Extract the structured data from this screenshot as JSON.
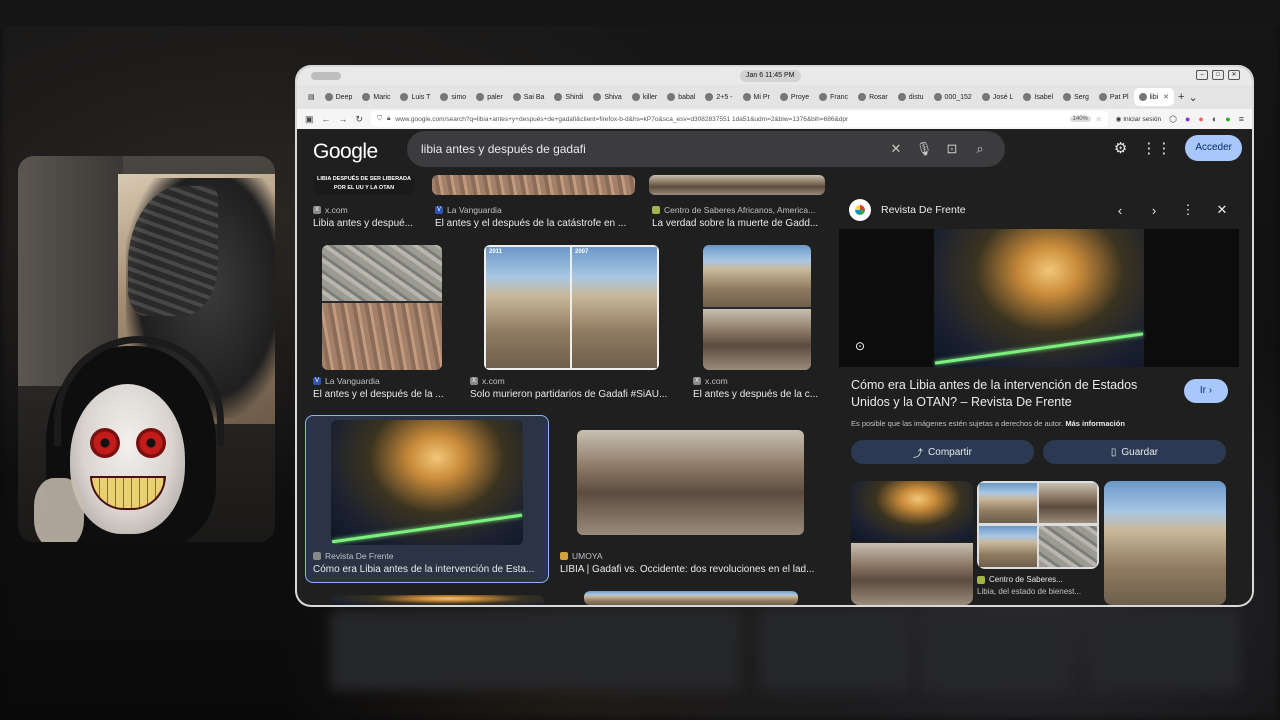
{
  "os": {
    "clock": "Jan 6  11:45 PM"
  },
  "browser": {
    "tabs": [
      {
        "label": "Deep"
      },
      {
        "label": "Maric"
      },
      {
        "label": "Luis T"
      },
      {
        "label": "simo"
      },
      {
        "label": "paler"
      },
      {
        "label": "Sai Ba"
      },
      {
        "label": "Shirdi"
      },
      {
        "label": "Shiva"
      },
      {
        "label": "killer"
      },
      {
        "label": "babal"
      },
      {
        "label": "2+5 -"
      },
      {
        "label": "Mi Pr"
      },
      {
        "label": "Proye"
      },
      {
        "label": "Franc"
      },
      {
        "label": "Rosar"
      },
      {
        "label": "distu"
      },
      {
        "label": "000_152"
      },
      {
        "label": "José L"
      },
      {
        "label": "Isabel"
      },
      {
        "label": "Serg"
      },
      {
        "label": "Pat Pl"
      },
      {
        "label": "libi"
      }
    ],
    "url": "www.google.com/search?q=libia+antes+y+después+de+gadafi&client=firefox-b-d&hs=kP7o&sca_esv=d3082837551 1da51&udm=2&biw=1376&bih=686&dpr",
    "zoom": "140%",
    "session": "Iniciar sesión"
  },
  "google": {
    "logo": "Google",
    "query": "libia antes y después de gadafi",
    "signin": "Acceder"
  },
  "results": {
    "row1": [
      {
        "source": "x.com",
        "title": "Libia antes y despué...",
        "banner": "LIBIA DESPUÉS DE SER LIBERADA POR EL UU Y LA OTAN"
      },
      {
        "source": "La Vanguardia",
        "title": "El antes y el después de la catástrofe en ..."
      },
      {
        "source": "Centro de Saberes Africanos, America...",
        "title": "La verdad sobre la muerte de Gadd..."
      }
    ],
    "row2": [
      {
        "source": "La Vanguardia",
        "title": "El antes y el después de la ..."
      },
      {
        "source": "x.com",
        "title": "Solo murieron partidarios de Gadafi #SiAU...",
        "year1": "2011",
        "year2": "2007"
      },
      {
        "source": "x.com",
        "title": "El antes y después de la c..."
      }
    ],
    "row3": [
      {
        "source": "Revista De Frente",
        "title": "Cómo era Libia antes de la intervención de Esta..."
      },
      {
        "source": "UMOYA",
        "title": "LIBIA | Gadafi vs. Occidente: dos revoluciones en el lad..."
      }
    ]
  },
  "panel": {
    "site": "Revista De Frente",
    "title": "Cómo era Libia antes de la intervención de Estados Unidos y la OTAN? – Revista De Frente",
    "go": "Ir ›",
    "note": "Es posible que las imágenes estén sujetas a derechos de autor.",
    "more": "Más información",
    "share": "Compartir",
    "save": "Guardar",
    "related_source": "Centro de Saberes...",
    "related_title": "Libia, del estado de bienest..."
  },
  "icons": {
    "clear": "close-icon",
    "mic": "microphone-icon",
    "lens": "camera-search-icon",
    "search": "search-icon",
    "settings": "gear-icon",
    "apps": "apps-grid-icon"
  },
  "colors": {
    "accent": "#a8c7fa",
    "selected_border": "#8ab4f8",
    "page_bg": "#1f1f1f"
  }
}
